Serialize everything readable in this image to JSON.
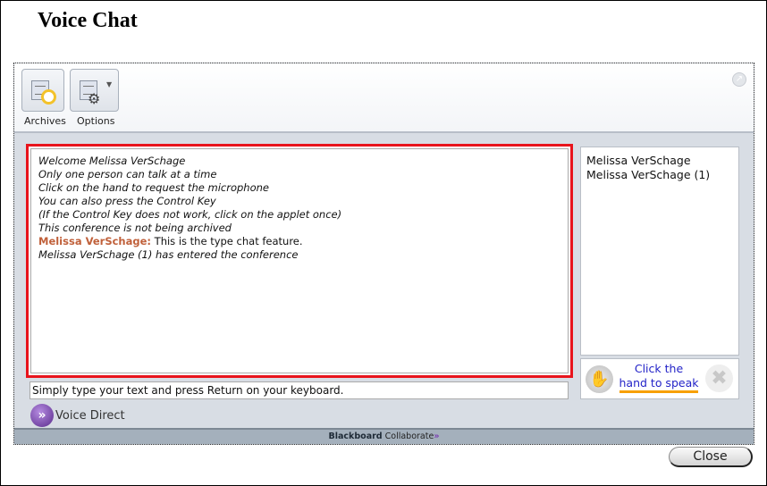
{
  "title": "Voice Chat",
  "toolbar": {
    "archives_label": "Archives",
    "options_label": "Options"
  },
  "chat": {
    "lines": [
      "Welcome Melissa VerSchage",
      "Only one person can talk at a time",
      "Click on the hand to request the microphone",
      "You can also press the Control Key",
      "(If the Control Key does not work, click on the applet once)",
      "This conference is not being archived"
    ],
    "message": {
      "sender": "Melissa VerSchage:",
      "text": " This is the type chat feature."
    },
    "last_line": "Melissa VerSchage (1) has entered the conference",
    "highlight_color": "#e8141c"
  },
  "users": [
    "Melissa VerSchage",
    "Melissa VerSchage (1)"
  ],
  "hand": {
    "line1": "Click the",
    "line2": "hand to speak"
  },
  "input": {
    "value": "Simply type your text and press Return on your keyboard."
  },
  "voice_direct": "Voice Direct",
  "footer": {
    "brand": "Blackboard",
    "product": " Collaborate"
  },
  "close_label": "Close"
}
